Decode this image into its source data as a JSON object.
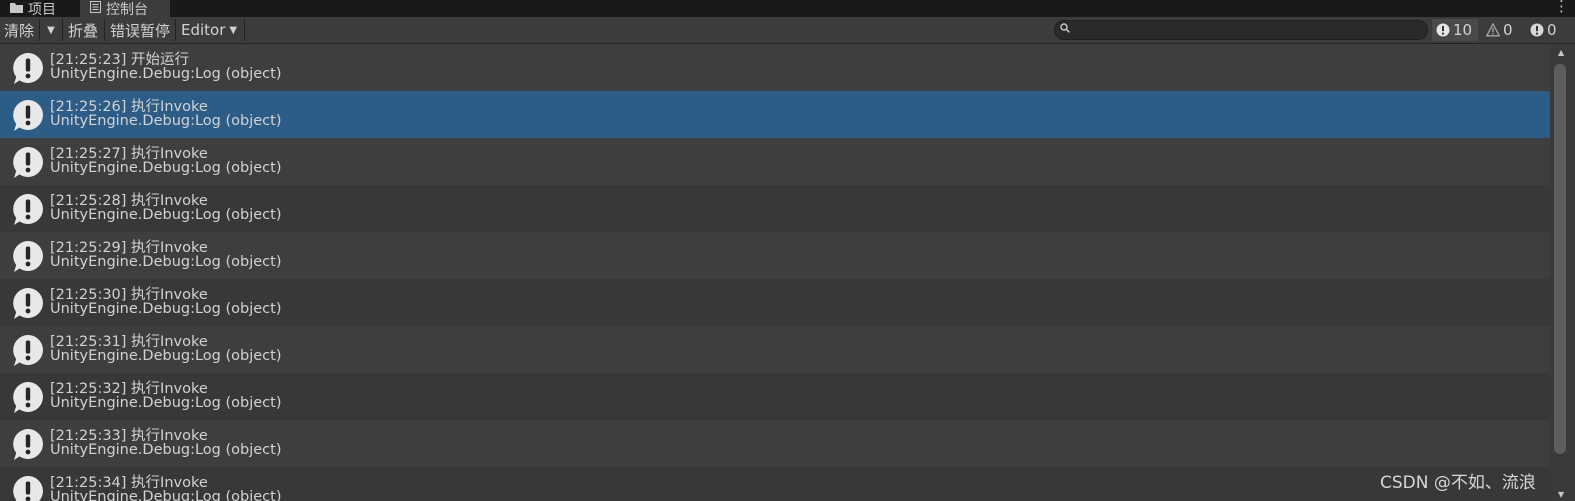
{
  "tabs": [
    {
      "label": "项目",
      "icon": "folder-icon"
    },
    {
      "label": "控制台",
      "icon": "console-icon"
    }
  ],
  "toolbar": {
    "clear_label": "清除",
    "collapse_label": "折叠",
    "error_pause_label": "错误暂停",
    "editor_label": "Editor"
  },
  "search": {
    "value": "",
    "placeholder": ""
  },
  "counters": {
    "logs": "10",
    "warnings": "0",
    "errors": "0"
  },
  "log_entries": [
    {
      "line1": "[21:25:23] 开始运行",
      "line2": "UnityEngine.Debug:Log (object)"
    },
    {
      "line1": "[21:25:26] 执行Invoke",
      "line2": "UnityEngine.Debug:Log (object)",
      "selected": true
    },
    {
      "line1": "[21:25:27] 执行Invoke",
      "line2": "UnityEngine.Debug:Log (object)"
    },
    {
      "line1": "[21:25:28] 执行Invoke",
      "line2": "UnityEngine.Debug:Log (object)"
    },
    {
      "line1": "[21:25:29] 执行Invoke",
      "line2": "UnityEngine.Debug:Log (object)"
    },
    {
      "line1": "[21:25:30] 执行Invoke",
      "line2": "UnityEngine.Debug:Log (object)"
    },
    {
      "line1": "[21:25:31] 执行Invoke",
      "line2": "UnityEngine.Debug:Log (object)"
    },
    {
      "line1": "[21:25:32] 执行Invoke",
      "line2": "UnityEngine.Debug:Log (object)"
    },
    {
      "line1": "[21:25:33] 执行Invoke",
      "line2": "UnityEngine.Debug:Log (object)"
    },
    {
      "line1": "[21:25:34] 执行Invoke",
      "line2": "UnityEngine.Debug:Log (object)"
    }
  ],
  "watermark": "CSDN @不如、流浪",
  "colors": {
    "selected_row": "#2c5d87",
    "background": "#383838"
  }
}
